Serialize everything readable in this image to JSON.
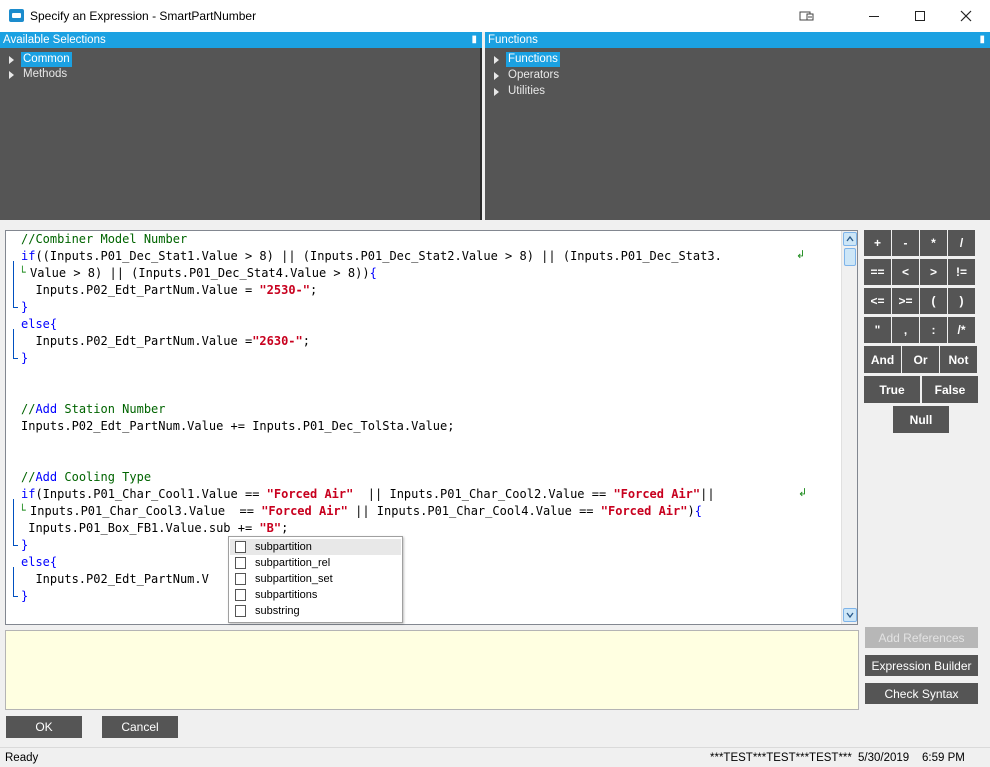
{
  "window": {
    "title": "Specify an Expression - SmartPartNumber",
    "icons": [
      "app-icon",
      "restore-icon",
      "minimize-icon",
      "maximize-icon",
      "close-icon"
    ]
  },
  "left_panel": {
    "title": "Available Selections",
    "items": [
      {
        "label": "Common",
        "selected": true
      },
      {
        "label": "Methods",
        "selected": false
      }
    ]
  },
  "right_panel": {
    "title": "Functions",
    "items": [
      {
        "label": "Functions",
        "selected": true
      },
      {
        "label": "Operators",
        "selected": false
      },
      {
        "label": "Utilities",
        "selected": false
      }
    ]
  },
  "code_lines": [
    "//Combiner Model Number",
    "if((Inputs.P01_Dec_Stat1.Value > 8) || (Inputs.P01_Dec_Stat2.Value > 8) || (Inputs.P01_Dec_Stat3.",
    "Value > 8) || (Inputs.P01_Dec_Stat4.Value > 8)){",
    "  Inputs.P02_Edt_PartNum.Value = \"2530-\";",
    "}",
    "else{",
    "  Inputs.P02_Edt_PartNum.Value =\"2630-\";",
    "}",
    "",
    "",
    "//Add Station Number",
    "Inputs.P02_Edt_PartNum.Value += Inputs.P01_Dec_TolSta.Value;",
    "",
    "",
    "//Add Cooling Type",
    "if(Inputs.P01_Char_Cool1.Value == \"Forced Air\"  || Inputs.P01_Char_Cool2.Value == \"Forced Air\"||",
    "Inputs.P01_Char_Cool3.Value  == \"Forced Air\" || Inputs.P01_Char_Cool4.Value == \"Forced Air\"){",
    " Inputs.P01_Box_FB1.Value.sub += \"B\";",
    "}",
    "else{",
    "  Inputs.P02_Edt_PartNum.V",
    "}"
  ],
  "autocomplete": {
    "items": [
      "subpartition",
      "subpartition_rel",
      "subpartition_set",
      "subpartitions",
      "substring"
    ],
    "selected_index": 0
  },
  "keypad": {
    "rows": [
      [
        "+",
        "-",
        "*",
        "/"
      ],
      [
        "==",
        "<",
        ">",
        "!="
      ],
      [
        "<=",
        ">=",
        "(",
        ")"
      ],
      [
        "\"",
        ",",
        ":",
        "/*"
      ],
      [
        "And",
        "Or",
        "Not"
      ],
      [
        "True",
        "False"
      ],
      [
        "Null"
      ]
    ]
  },
  "buttons": {
    "add_references": "Add References",
    "expression_builder": "Expression Builder",
    "check_syntax": "Check Syntax",
    "ok": "OK",
    "cancel": "Cancel"
  },
  "status": {
    "text": "Ready",
    "user": "***TEST***TEST***TEST***",
    "date": "5/30/2019",
    "time": "6:59 PM"
  },
  "colors": {
    "accent": "#1ba1e2",
    "panel": "#555555",
    "keyword": "#0000ff",
    "string": "#c8001e",
    "comment": "#006400"
  }
}
